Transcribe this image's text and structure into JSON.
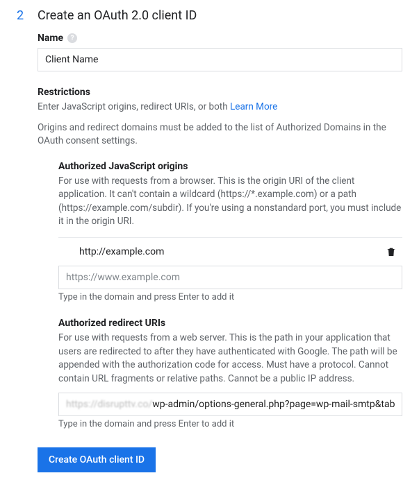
{
  "step": {
    "number": "2",
    "title": "Create an OAuth 2.0 client ID"
  },
  "name": {
    "label": "Name",
    "value": "Client Name"
  },
  "restrictions": {
    "title": "Restrictions",
    "desc_prefix": "Enter JavaScript origins, redirect URIs, or both ",
    "learn_more": "Learn More",
    "domains_note_prefix": "Origins and redirect domains must be added to the list of Authorized Domains in the ",
    "consent_link": "OAuth consent settings",
    "domains_note_suffix": "."
  },
  "js_origins": {
    "title": "Authorized JavaScript origins",
    "desc": "For use with requests from a browser. This is the origin URI of the client application. It can't contain a wildcard (https://*.example.com) or a path (https://example.com/subdir). If you're using a nonstandard port, you must include it in the origin URI.",
    "items": [
      "http://example.com"
    ],
    "placeholder": "https://www.example.com",
    "hint": "Type in the domain and press Enter to add it"
  },
  "redirect_uris": {
    "title": "Authorized redirect URIs",
    "desc": "For use with requests from a web server. This is the path in your application that users are redirected to after they have authenticated with Google. The path will be appended with the authorization code for access. Must have a protocol. Cannot contain URL fragments or relative paths. Cannot be a public IP address.",
    "value_host": "https://disrupttv.co/",
    "value_path": "wp-admin/options-general.php?page=wp-mail-smtp&tab",
    "hint": "Type in the domain and press Enter to add it"
  },
  "submit": {
    "label": "Create OAuth client ID"
  },
  "icons": {
    "help": "?",
    "trash": "trash"
  }
}
